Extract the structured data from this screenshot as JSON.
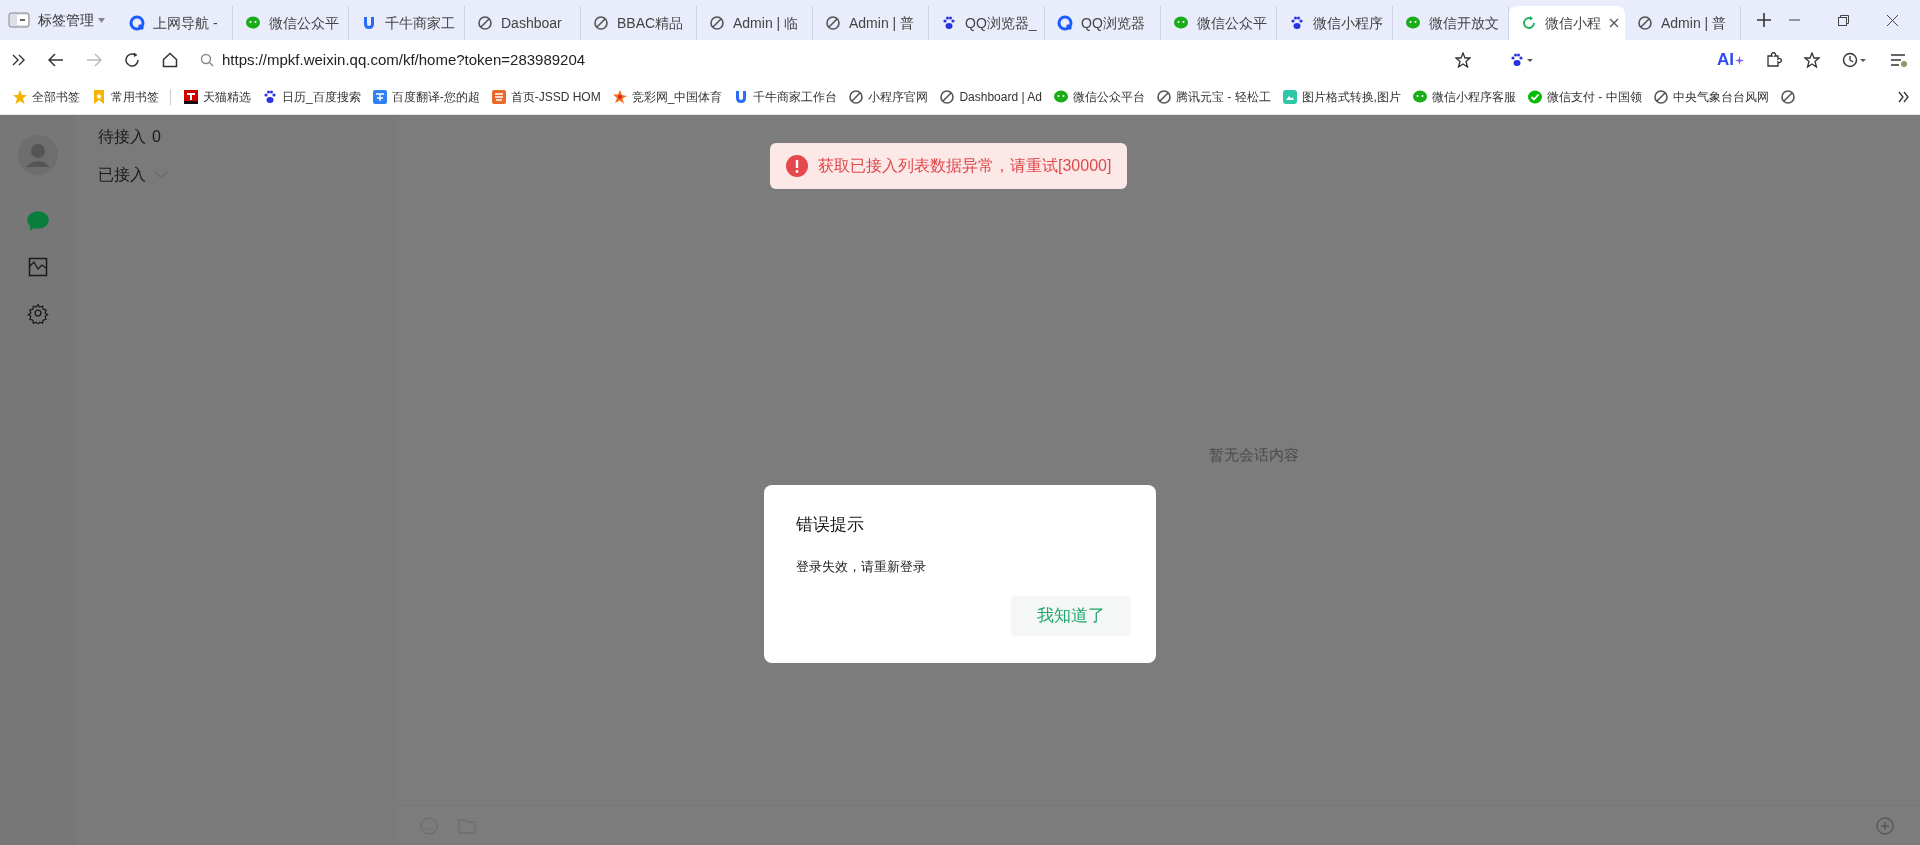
{
  "browser": {
    "tab_manager": "标签管理",
    "tabs": [
      {
        "title": "上网导航 -",
        "kind": "q",
        "selected": false
      },
      {
        "title": "微信公众平",
        "kind": "wechat",
        "selected": false
      },
      {
        "title": "千牛商家工",
        "kind": "shield",
        "selected": false
      },
      {
        "title": "Dashboar",
        "kind": "leaf",
        "selected": false
      },
      {
        "title": "BBAC精品",
        "kind": "leaf",
        "selected": false
      },
      {
        "title": "Admin | 临",
        "kind": "leaf",
        "selected": false
      },
      {
        "title": "Admin | 普",
        "kind": "leaf",
        "selected": false
      },
      {
        "title": "QQ浏览器_",
        "kind": "paw",
        "selected": false
      },
      {
        "title": "QQ浏览器",
        "kind": "q",
        "selected": false
      },
      {
        "title": "微信公众平",
        "kind": "wechat",
        "selected": false
      },
      {
        "title": "微信小程序",
        "kind": "paw",
        "selected": false
      },
      {
        "title": "微信开放文",
        "kind": "wechat",
        "selected": false
      },
      {
        "title": "微信小程",
        "kind": "refresh",
        "selected": true
      },
      {
        "title": "Admin | 普",
        "kind": "leaf",
        "selected": false
      }
    ],
    "url": "https://mpkf.weixin.qq.com/kf/home?token=283989204",
    "ai_label": "AI",
    "bookmarks": [
      {
        "label": "全部书签",
        "kind": "star"
      },
      {
        "label": "常用书签",
        "kind": "flag"
      },
      {
        "label": "天猫精选",
        "kind": "tmall"
      },
      {
        "label": "日历_百度搜索",
        "kind": "paw"
      },
      {
        "label": "百度翻译-您的超",
        "kind": "translate"
      },
      {
        "label": "首页-JSSD HOM",
        "kind": "orange"
      },
      {
        "label": "竞彩网_中国体育",
        "kind": "starburst"
      },
      {
        "label": "千牛商家工作台",
        "kind": "shield"
      },
      {
        "label": "小程序官网",
        "kind": "leaf"
      },
      {
        "label": "Dashboard | Ad",
        "kind": "leaf"
      },
      {
        "label": "微信公众平台",
        "kind": "wechat"
      },
      {
        "label": "腾讯元宝 - 轻松工",
        "kind": "leaf"
      },
      {
        "label": "图片格式转换,图片",
        "kind": "image"
      },
      {
        "label": "微信小程序客服",
        "kind": "wechat"
      },
      {
        "label": "微信支付 - 中国领",
        "kind": "pay"
      },
      {
        "label": "中央气象台台风网",
        "kind": "leaf"
      }
    ]
  },
  "sidebar": {
    "items": [
      {
        "kind": "chat",
        "selected": true
      },
      {
        "kind": "chart",
        "selected": false
      },
      {
        "kind": "settings",
        "selected": false
      }
    ]
  },
  "session_list": {
    "waiting_label": "待接入",
    "waiting_count": "0",
    "accepted_label": "已接入"
  },
  "main": {
    "empty_text": "暂无会话内容"
  },
  "toast": {
    "message": "获取已接入列表数据异常，请重试[30000]"
  },
  "dialog": {
    "title": "错误提示",
    "message": "登录失效，请重新登录",
    "button": "我知道了"
  }
}
